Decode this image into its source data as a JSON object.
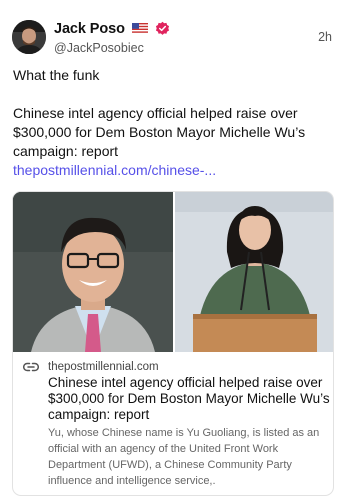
{
  "author": {
    "display_name": "Jack Poso",
    "handle": "@JackPosobiec",
    "avatar_icon": "avatar-photo",
    "flag_icon": "us-flag-icon",
    "verified_icon": "verified-badge-icon",
    "verified_color": "#e0245e"
  },
  "post": {
    "time": "2h",
    "line1": "What the funk",
    "line2": "Chinese intel agency official helped raise over $300,000 for Dem Boston Mayor Michelle Wu’s campaign: report",
    "link_text": "thepostmillennial.com/chinese-...",
    "link_color": "#5650e8"
  },
  "card": {
    "domain": "thepostmillennial.com",
    "title": "Chinese intel agency official helped raise over $300,000 for Dem Boston Mayor Michelle Wu’s campaign: report",
    "description": "Yu, whose Chinese name is Yu Guoliang, is listed as an official with an agency of the United Front Work Department (UFWD), a Chinese Community Party influence and intelligence service,.",
    "link_icon": "link-icon"
  }
}
